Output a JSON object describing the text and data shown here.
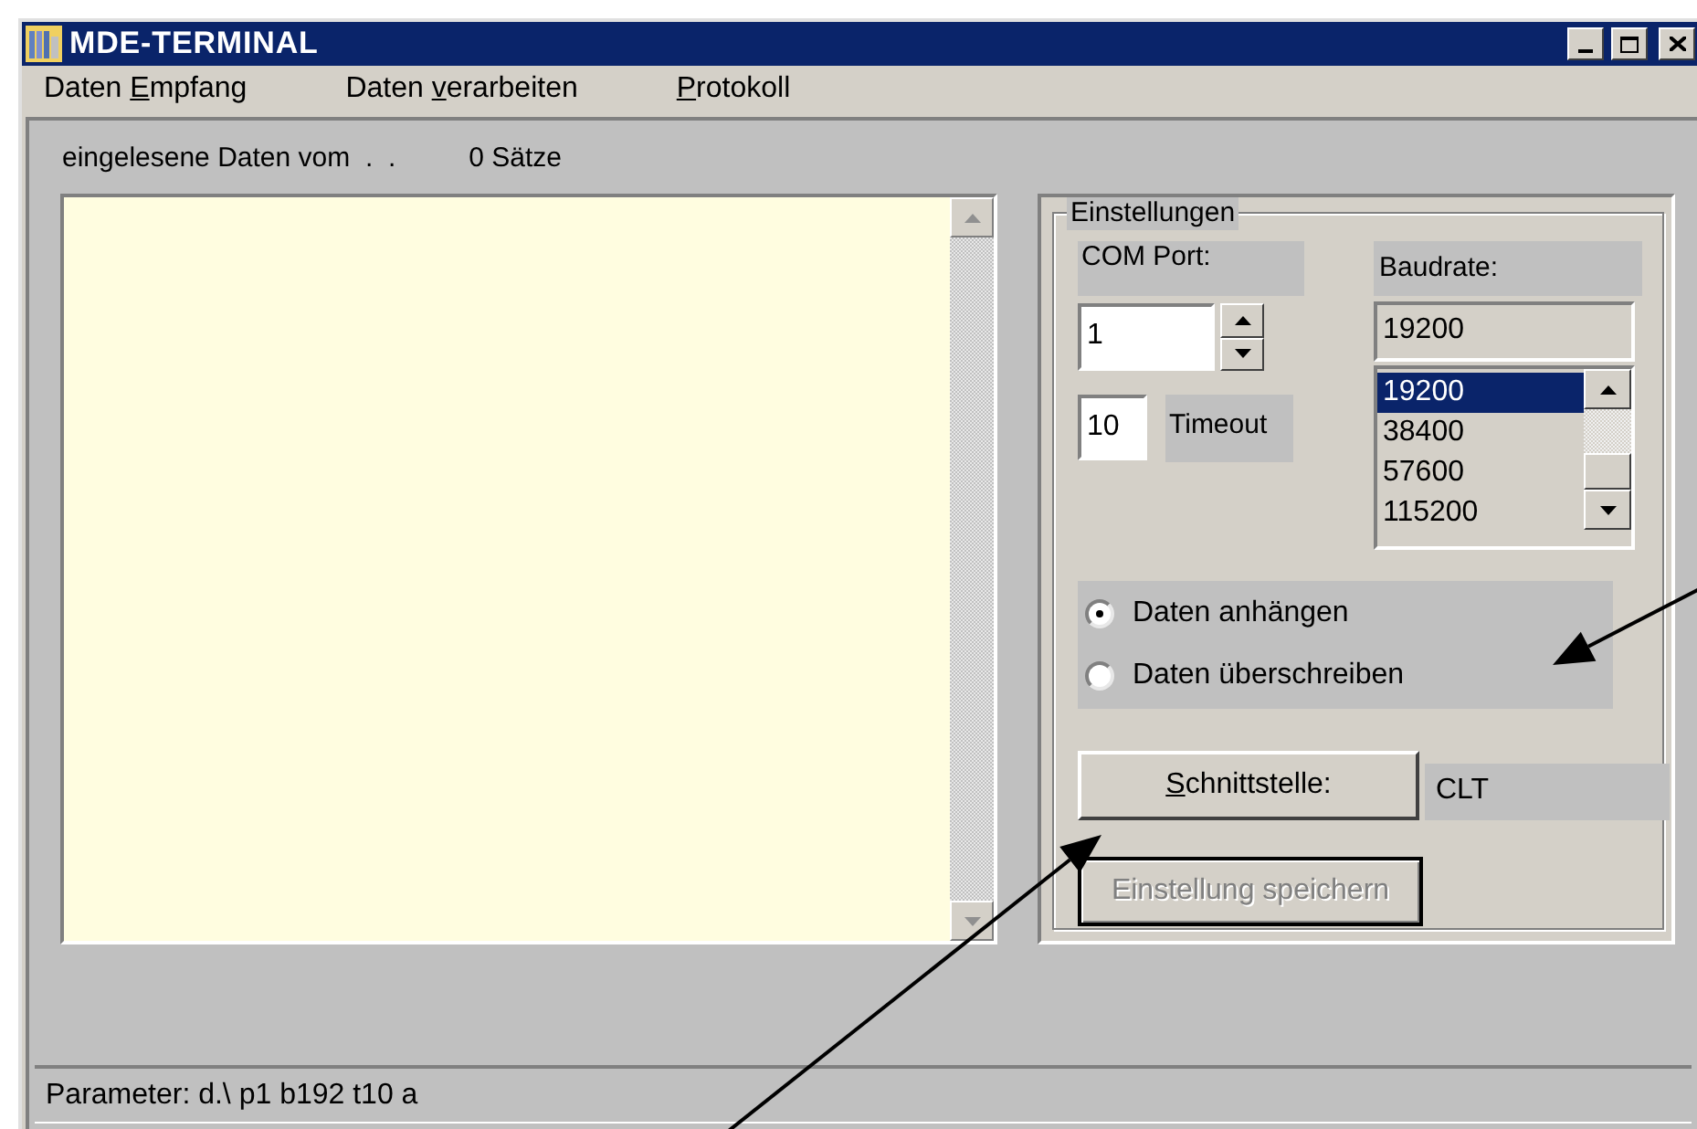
{
  "window": {
    "title": "MDE-TERMINAL"
  },
  "menu": [
    {
      "before": "Daten ",
      "mnemonic": "E",
      "after": "mpfang"
    },
    {
      "before": "Daten ",
      "mnemonic": "v",
      "after": "erarbeiten"
    },
    {
      "mnemonic": "P",
      "after": "rotokoll"
    }
  ],
  "header": {
    "label": "eingelesene Daten vom  .  .",
    "count": "0 Sätze"
  },
  "settings": {
    "title": "Einstellungen",
    "com_port": {
      "label": "COM Port:",
      "value": "1"
    },
    "baudrate": {
      "label": "Baudrate:",
      "value": "19200",
      "options": [
        {
          "label": "19200",
          "selected": true
        },
        {
          "label": "38400",
          "selected": false
        },
        {
          "label": "57600",
          "selected": false
        },
        {
          "label": "115200",
          "selected": false
        }
      ]
    },
    "timeout": {
      "value": "10",
      "label": "Timeout"
    },
    "write_mode": [
      {
        "label": "Daten anhängen",
        "selected": true
      },
      {
        "label": "Daten überschreiben",
        "selected": false
      }
    ],
    "interface": {
      "button": {
        "mnemonic": "S",
        "after": "chnittstelle:"
      },
      "value": "CLT"
    },
    "save_button": {
      "label": "Einstellung speichern",
      "disabled": true
    }
  },
  "status_bar": "Parameter: d.\\ p1 b192 t10 a"
}
